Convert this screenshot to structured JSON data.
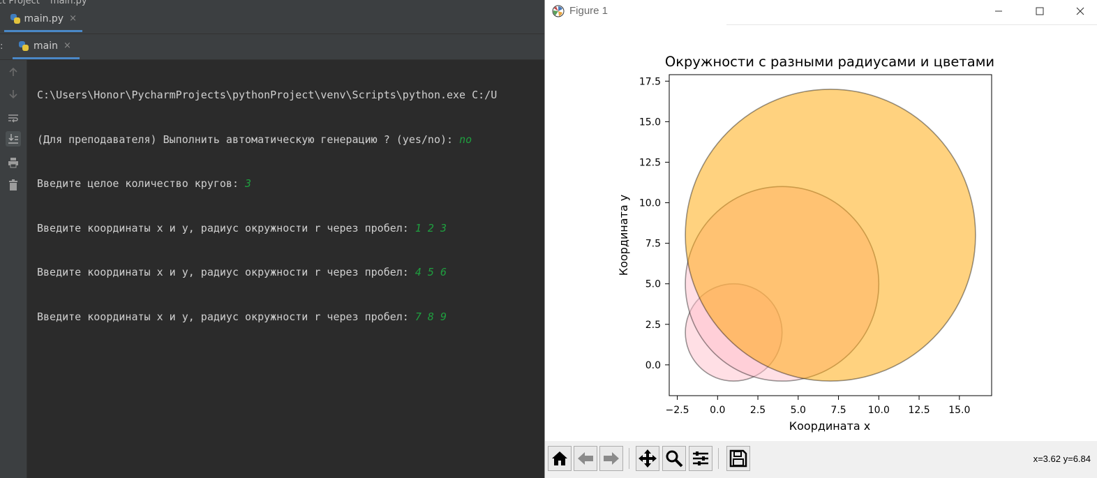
{
  "ide": {
    "breadcrumb": {
      "project": "ct Project",
      "file": "main.py"
    },
    "editor_tab": {
      "label": "main.py",
      "close": "×"
    },
    "run_tab": {
      "label": "main",
      "close": "×"
    },
    "console": {
      "lines": [
        {
          "text": "C:\\Users\\Honor\\PycharmProjects\\pythonProject\\venv\\Scripts\\python.exe C:/U",
          "input": ""
        },
        {
          "text": "(Для преподавателя) Выполнить автоматическую генерацию ? (yes/no): ",
          "input": "no"
        },
        {
          "text": "Введите целое количество кругов: ",
          "input": "3"
        },
        {
          "text": "Введите координаты x и y, радиус окружности r через пробел: ",
          "input": "1 2 3"
        },
        {
          "text": "Введите координаты x и y, радиус окружности r через пробел: ",
          "input": "4 5 6"
        },
        {
          "text": "Введите координаты x и y, радиус окружности r через пробел: ",
          "input": "7 8 9"
        }
      ]
    },
    "gutter_icons": [
      "arrow-up-icon",
      "arrow-down-icon",
      "soft-wrap-icon",
      "scroll-to-end-icon",
      "print-icon",
      "trash-icon"
    ]
  },
  "figure": {
    "window_title": "Figure 1",
    "coords_readout": "x=3.62 y=6.84",
    "toolbar_icons": [
      "home-icon",
      "back-icon",
      "forward-icon",
      "pan-icon",
      "zoom-icon",
      "configure-subplots-icon",
      "save-icon"
    ],
    "colors": {
      "pink": "#ffc0cb",
      "orange": "#ffa500",
      "edge": "#000000"
    }
  },
  "chart_data": {
    "type": "scatter",
    "title": "Окружности с разными радиусами и цветами",
    "xlabel": "Координата x",
    "ylabel": "Координата y",
    "xlim": [
      -3,
      17
    ],
    "ylim": [
      -1.9,
      17.9
    ],
    "xticks": [
      -2.5,
      0.0,
      2.5,
      5.0,
      7.5,
      10.0,
      12.5,
      15.0
    ],
    "xtick_labels": [
      "−2.5",
      "0.0",
      "2.5",
      "5.0",
      "7.5",
      "10.0",
      "12.5",
      "15.0"
    ],
    "yticks": [
      0.0,
      2.5,
      5.0,
      7.5,
      10.0,
      12.5,
      15.0,
      17.5
    ],
    "ytick_labels": [
      "0.0",
      "2.5",
      "5.0",
      "7.5",
      "10.0",
      "12.5",
      "15.0",
      "17.5"
    ],
    "grid": false,
    "circles": [
      {
        "x": 1,
        "y": 2,
        "r": 3,
        "color": "#ffc0cb",
        "alpha": 0.5
      },
      {
        "x": 4,
        "y": 5,
        "r": 6,
        "color": "#ffc0cb",
        "alpha": 0.5
      },
      {
        "x": 7,
        "y": 8,
        "r": 9,
        "color": "#ffa500",
        "alpha": 0.5
      }
    ]
  }
}
